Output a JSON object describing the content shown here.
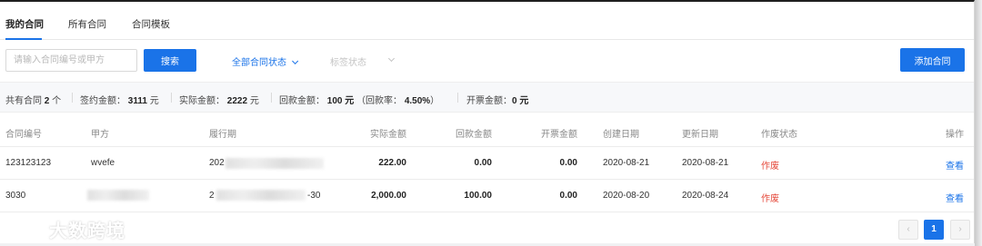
{
  "tabs": [
    {
      "label": "我的合同",
      "active": true
    },
    {
      "label": "所有合同",
      "active": false
    },
    {
      "label": "合同模板",
      "active": false
    }
  ],
  "filters": {
    "search_placeholder": "请输入合同编号或甲方",
    "search_button": "搜索",
    "status_select": "全部合同状态",
    "tag_select": "标签状态",
    "add_button": "添加合同"
  },
  "summary": {
    "total_prefix": "共有合同",
    "total_count": "2",
    "total_suffix": "个",
    "signed_label": "签约金额：",
    "signed_value": "3111",
    "signed_unit": "元",
    "actual_label": "实际金额：",
    "actual_value": "2222",
    "actual_unit": "元",
    "returned_label": "回款金额：",
    "returned_value": "100 元",
    "rate_label": "（回款率：",
    "rate_value": "4.50%",
    "rate_close": "）",
    "invoice_label": "开票金额：",
    "invoice_value": "0 元"
  },
  "table": {
    "headers": [
      "合同编号",
      "甲方",
      "履行期",
      "实际金额",
      "回款金额",
      "开票金额",
      "创建日期",
      "更新日期",
      "作废状态",
      "操作"
    ],
    "rows": [
      {
        "code": "123123123",
        "party": "wvefe",
        "period": "202",
        "actual": "222.00",
        "returned": "0.00",
        "invoice": "0.00",
        "created": "2020-08-21",
        "updated": "2020-08-21",
        "status": "作废",
        "action": "查看"
      },
      {
        "code": "3030",
        "party": "",
        "period_start": "2",
        "period_end": "-30",
        "actual": "2,000.00",
        "returned": "100.00",
        "invoice": "0.00",
        "created": "2020-08-20",
        "updated": "2020-08-24",
        "status": "作废",
        "action": "查看"
      }
    ]
  },
  "pagination": {
    "prev": "‹",
    "page": "1",
    "next": "›"
  },
  "watermark": "大数跨境",
  "colors": {
    "accent": "#1a73e8",
    "danger": "#e5483a"
  }
}
